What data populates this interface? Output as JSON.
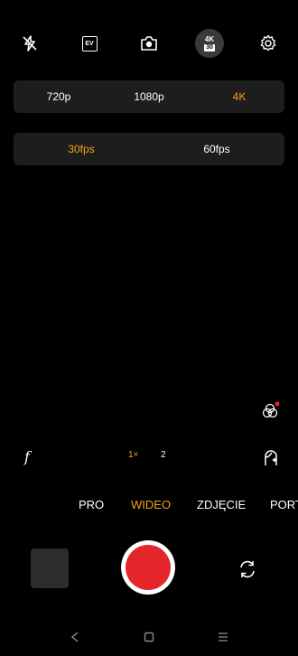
{
  "top_bar": {
    "icons": [
      "flash-off-icon",
      "exposure-ev-icon",
      "camera-icon",
      "resolution-4k30-icon",
      "settings-gear-icon"
    ],
    "ev_label": "EV",
    "res_badge_top": "4K",
    "res_badge_bottom": "30"
  },
  "resolution": {
    "options": [
      "720p",
      "1080p",
      "4K"
    ],
    "selected": "4K"
  },
  "framerate": {
    "options": [
      "30fps",
      "60fps"
    ],
    "selected": "30fps"
  },
  "filters_icon": "filters-icon",
  "left_tool_label": "f",
  "zoom": {
    "options": [
      "1×",
      "2"
    ],
    "selected": "1×"
  },
  "modes": {
    "items": [
      "PRO",
      "WIDEO",
      "ZDJĘCIE",
      "PORT"
    ],
    "selected": "WIDEO"
  },
  "colors": {
    "accent": "#f0a11d",
    "record": "#e4262b",
    "panel": "#1d1d1d"
  },
  "nav": [
    "back-icon",
    "home-icon",
    "recents-icon"
  ]
}
